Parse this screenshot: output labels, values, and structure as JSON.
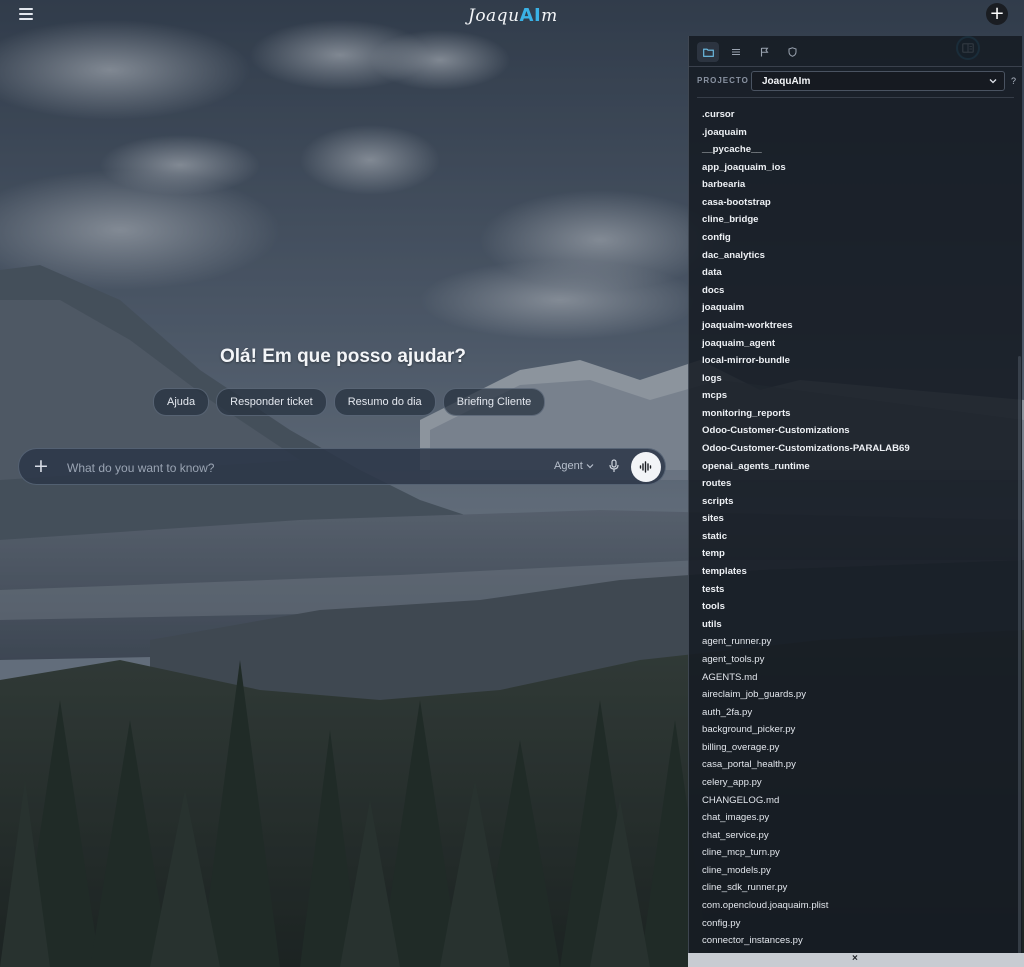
{
  "app": {
    "logo_prefix": "Joaqu",
    "logo_ai": "AI",
    "logo_suffix": "m"
  },
  "header": {
    "menu_icon": "hamburger-icon",
    "panel_toggle_icon": "panel-layout-icon",
    "new_icon": "plus-icon",
    "new_label": "+"
  },
  "main": {
    "greeting": "Olá! Em que posso ajudar?",
    "chips": [
      "Ajuda",
      "Responder ticket",
      "Resumo do dia",
      "Briefing Cliente"
    ],
    "composer": {
      "add_label": "+",
      "placeholder": "What do you want to know?",
      "mode_label": "Agent",
      "mic_icon": "microphone-icon",
      "voice_icon": "voice-waveform-icon"
    }
  },
  "panel": {
    "tabs": [
      "folder-icon",
      "list-icon",
      "flag-icon",
      "shield-icon"
    ],
    "project_label": "PROJECTO",
    "project_value": "JoaquAIm",
    "help_label": "?",
    "close_label": "×",
    "folders": [
      ".cursor",
      ".joaquaim",
      "__pycache__",
      "app_joaquaim_ios",
      "barbearia",
      "casa-bootstrap",
      "cline_bridge",
      "config",
      "dac_analytics",
      "data",
      "docs",
      "joaquaim",
      "joaquaim-worktrees",
      "joaquaim_agent",
      "local-mirror-bundle",
      "logs",
      "mcps",
      "monitoring_reports",
      "Odoo-Customer-Customizations",
      "Odoo-Customer-Customizations-PARALAB69",
      "openai_agents_runtime",
      "routes",
      "scripts",
      "sites",
      "static",
      "temp",
      "templates",
      "tests",
      "tools",
      "utils"
    ],
    "files": [
      "agent_runner.py",
      "agent_tools.py",
      "AGENTS.md",
      "aireclaim_job_guards.py",
      "auth_2fa.py",
      "background_picker.py",
      "billing_overage.py",
      "casa_portal_health.py",
      "celery_app.py",
      "CHANGELOG.md",
      "chat_images.py",
      "chat_service.py",
      "cline_mcp_turn.py",
      "cline_models.py",
      "cline_sdk_runner.py",
      "com.opencloud.joaquaim.plist",
      "config.py",
      "connector_instances.py"
    ]
  },
  "colors": {
    "accent": "#3ab2e6",
    "panel_bg": "#161b23",
    "chip_bg": "#26303e"
  }
}
